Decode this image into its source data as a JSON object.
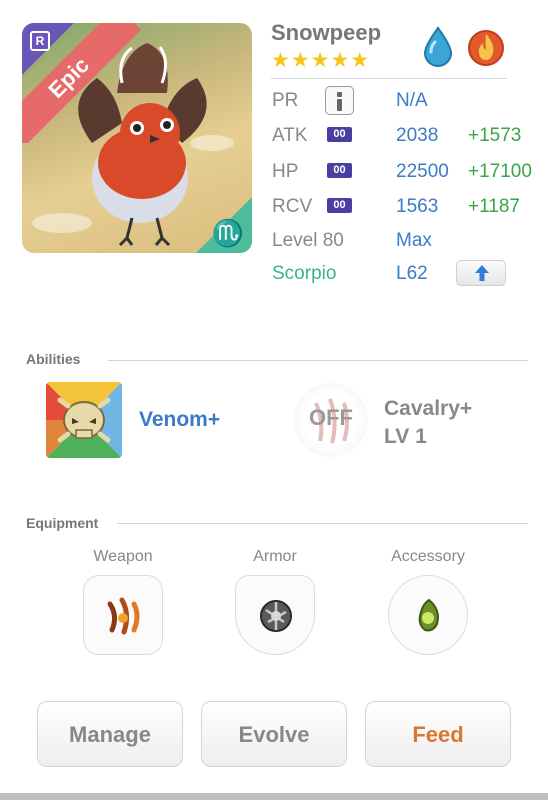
{
  "monster": {
    "name": "Snowpeep",
    "stars": "★★★★★",
    "rarity": "Epic",
    "rarity_badge": "R",
    "zodiac_glyph": "♏",
    "elements": [
      "water-drop-icon",
      "fire-icon"
    ]
  },
  "stats": {
    "pr": {
      "label": "PR",
      "value": "N/A"
    },
    "atk": {
      "label": "ATK",
      "tag": "00",
      "value": "2038",
      "bonus": "+1573"
    },
    "hp": {
      "label": "HP",
      "tag": "00",
      "value": "22500",
      "bonus": "+17100"
    },
    "rcv": {
      "label": "RCV",
      "tag": "00",
      "value": "1563",
      "bonus": "+1187"
    },
    "level": {
      "label": "Level 80",
      "value": "Max"
    },
    "zodiac": {
      "label": "Scorpio",
      "value": "L62"
    }
  },
  "abilities": {
    "title": "Abilities",
    "primary": {
      "name": "Venom+",
      "icon": "skull-icon"
    },
    "secondary": {
      "state": "OFF",
      "name": "Cavalry+",
      "level": "LV 1",
      "icon": "claw-icon"
    }
  },
  "equipment": {
    "title": "Equipment",
    "slots": [
      {
        "label": "Weapon",
        "icon": "claw-weapon-icon"
      },
      {
        "label": "Armor",
        "icon": "metal-armor-icon"
      },
      {
        "label": "Accessory",
        "icon": "leaf-gem-icon"
      }
    ]
  },
  "actions": {
    "manage": "Manage",
    "evolve": "Evolve",
    "feed": "Feed"
  },
  "colors": {
    "accent_blue": "#3b7bc7",
    "bonus_green": "#3aa544",
    "zodiac_teal": "#3bb38b",
    "epic_red": "#e66a6a",
    "feed_orange": "#d9772f"
  }
}
